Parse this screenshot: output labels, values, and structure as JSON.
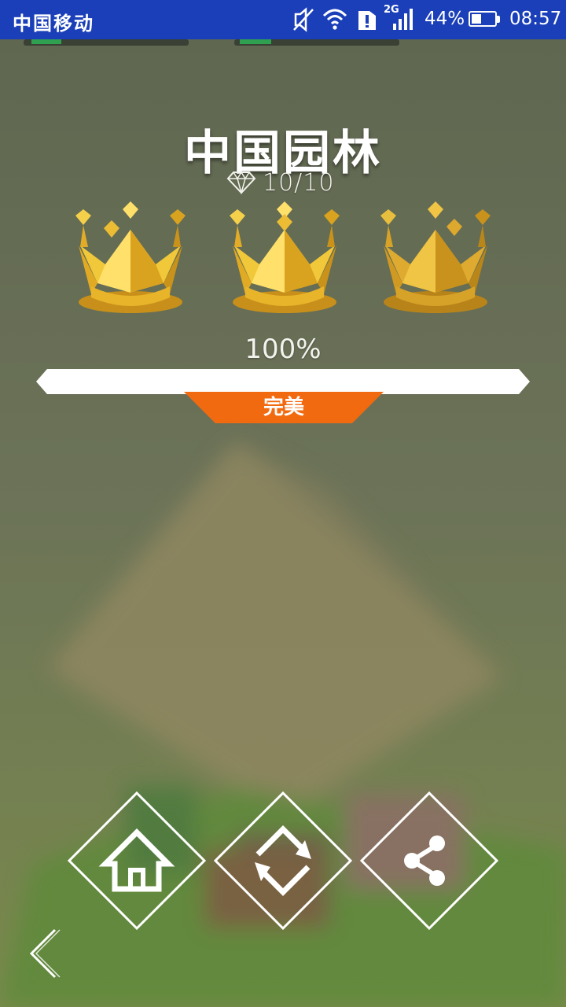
{
  "status_bar": {
    "carrier": "中国移动",
    "network": "2G",
    "battery_percent": "44%",
    "battery_level": 0.44,
    "time": "08:57",
    "icons": [
      "mute-icon",
      "wifi-icon",
      "sim-alert-icon",
      "signal-icon",
      "battery-icon"
    ]
  },
  "level": {
    "title": "中国园林",
    "gems": "10/10",
    "crowns_earned": 3,
    "crowns_total": 3,
    "progress_text": "100%",
    "progress": 1.0,
    "rating": "完美"
  },
  "colors": {
    "status_bar": "#1a3fb8",
    "crown_gold": "#e6b21e",
    "rating_orange": "#f26a10",
    "progress_fill": "#ffffff"
  },
  "buttons": {
    "home": "home-icon",
    "restart": "restart-icon",
    "share": "share-icon",
    "back": "back-chevron-icon"
  }
}
